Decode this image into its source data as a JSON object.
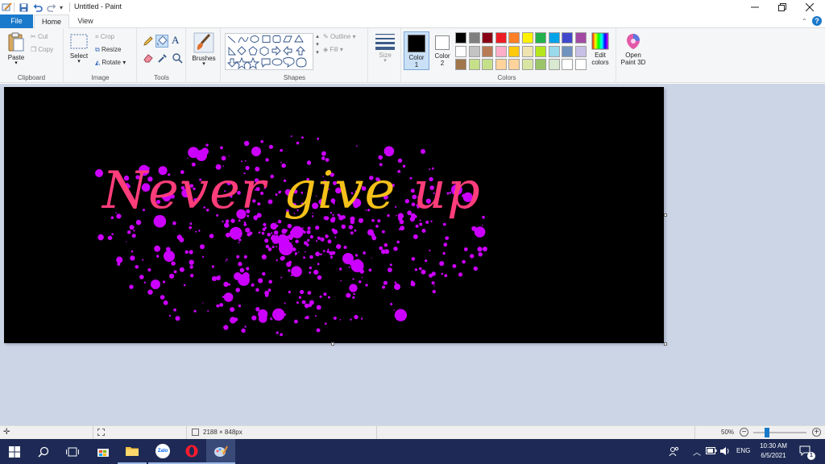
{
  "window": {
    "title": "Untitled - Paint"
  },
  "tabs": {
    "file": "File",
    "home": "Home",
    "view": "View"
  },
  "ribbon": {
    "clipboard": {
      "paste": "Paste",
      "cut": "Cut",
      "copy": "Copy",
      "label": "Clipboard"
    },
    "image": {
      "select": "Select",
      "crop": "Crop",
      "resize": "Resize",
      "rotate": "Rotate",
      "label": "Image"
    },
    "tools": {
      "label": "Tools"
    },
    "brushes": {
      "label": "Brushes"
    },
    "shapes": {
      "outline": "Outline",
      "fill": "Fill",
      "label": "Shapes"
    },
    "size": {
      "label": "Size"
    },
    "color1": {
      "line1": "Color",
      "line2": "1"
    },
    "color2": {
      "line1": "Color",
      "line2": "2"
    },
    "colors": {
      "label": "Colors",
      "row1": [
        "#000000",
        "#7f7f7f",
        "#880015",
        "#ed1c24",
        "#ff7f27",
        "#fff200",
        "#22b14c",
        "#00a2e8",
        "#3f48cc",
        "#a349a4"
      ],
      "row2": [
        "#ffffff",
        "#c3c3c3",
        "#b97a57",
        "#ffaec9",
        "#ffc90e",
        "#efe4b0",
        "#b5e61d",
        "#99d9ea",
        "#7092be",
        "#c8bfe7"
      ],
      "row3": [
        "#a0764a",
        "#c6e08a",
        "#c6e08a",
        "#ffd39b",
        "#ffd39b",
        "#d9e6a3",
        "#9bc46a",
        "#d9e8d0",
        "#ffffff",
        "#ffffff"
      ]
    },
    "edit_colors": {
      "line1": "Edit",
      "line2": "colors"
    },
    "paint3d": {
      "line1": "Open",
      "line2": "Paint 3D"
    }
  },
  "canvas": {
    "text_never": "Never",
    "text_give": "give",
    "text_up": "up",
    "colors": {
      "never": "#ff3d7a",
      "give": "#f4c11a",
      "up": "#ff3d7a",
      "splash": "#cc00ff"
    }
  },
  "statusbar": {
    "dimensions": "2188 × 848px",
    "zoom": "50%"
  },
  "taskbar": {
    "lang": "ENG",
    "time": "10:30 AM",
    "date": "6/5/2021",
    "zalo": "Zalo",
    "notification_count": "1"
  }
}
